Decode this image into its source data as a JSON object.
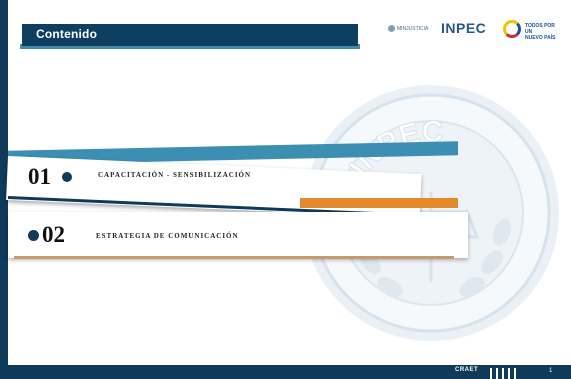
{
  "title": "Contenido",
  "logos": {
    "ministry": "MINJUSTICIA",
    "inpec": "INPEC",
    "gov_line1": "TODOS POR UN",
    "gov_line2": "NUEVO PAÍS"
  },
  "seal": {
    "text": "INPEC"
  },
  "items": [
    {
      "number": "01",
      "label": "CAPACITACIÓN - SENSIBILIZACIÓN"
    },
    {
      "number": "02",
      "label": "ESTRATEGIA DE COMUNICACIÓN"
    }
  ],
  "footer": {
    "brand": "CRAET",
    "page": "1"
  },
  "colors": {
    "navy": "#0f3a5a",
    "accent_blue": "#3c8fb3",
    "accent_orange": "#e58a2b"
  }
}
